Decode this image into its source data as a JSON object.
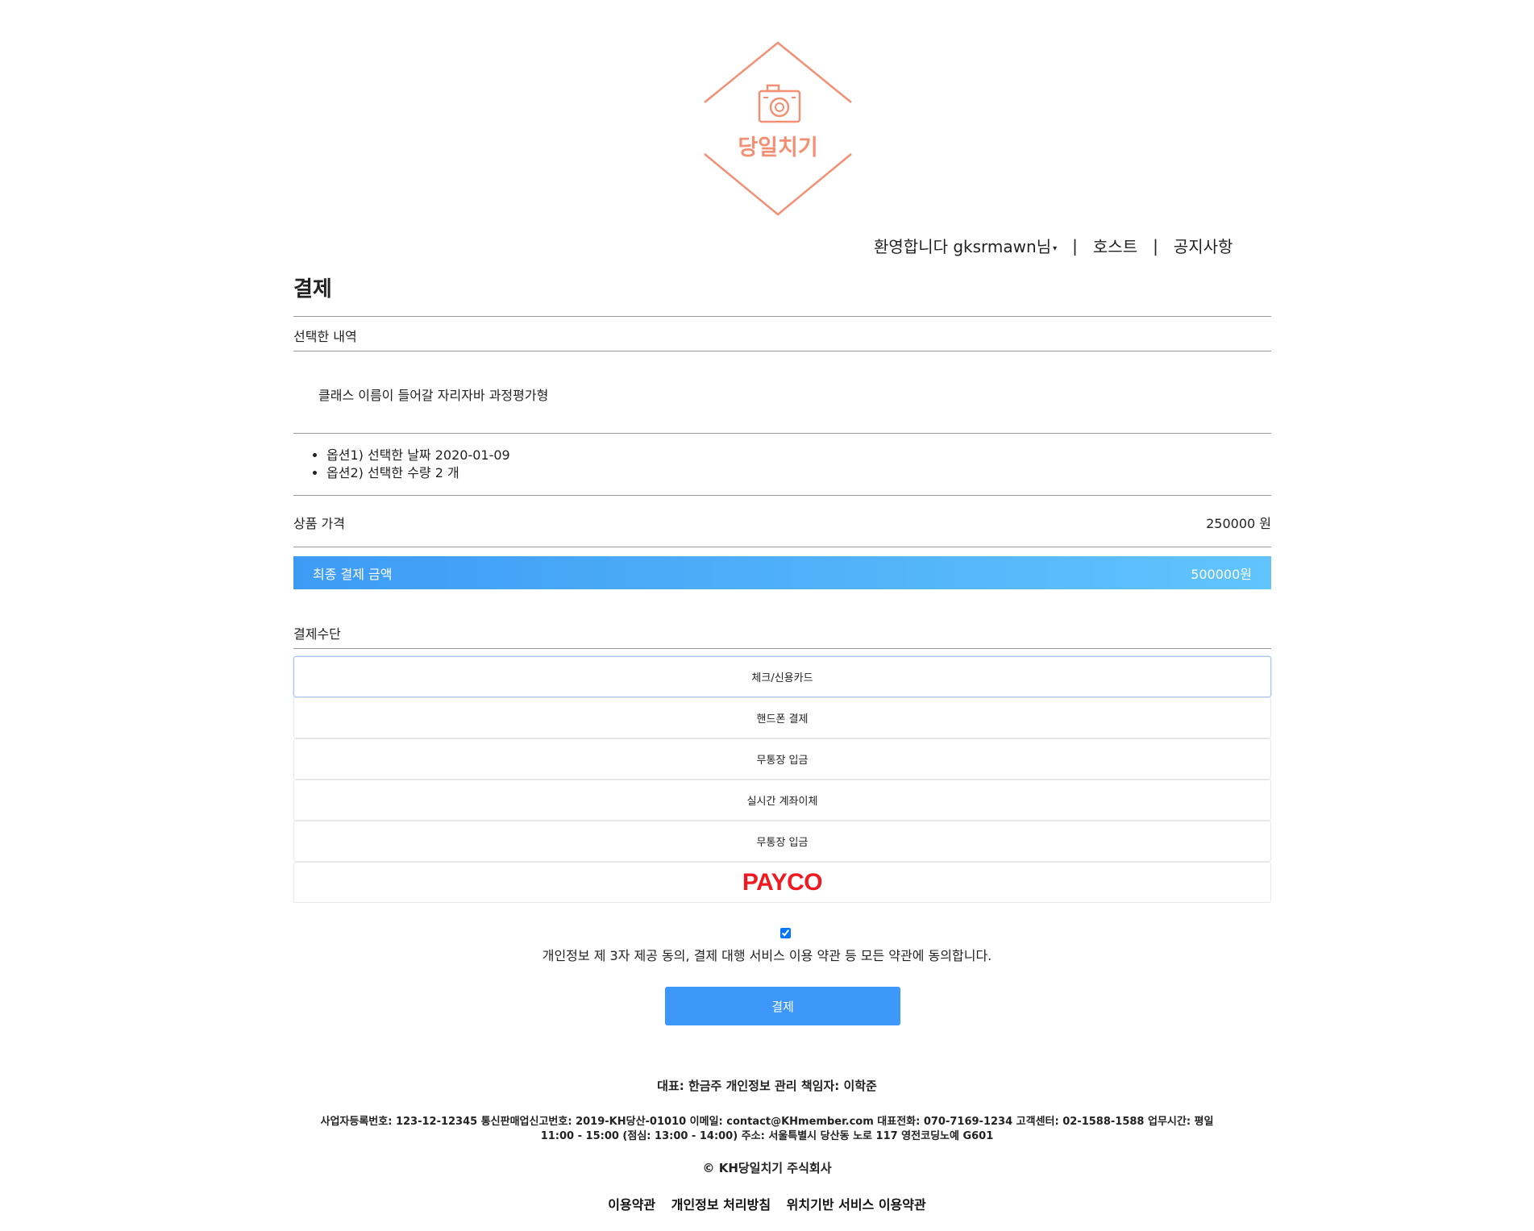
{
  "logo": {
    "brand_text": "당일치기",
    "accent_color": "#f39074",
    "icon": "camera-icon"
  },
  "topnav": {
    "welcome": "환영합니다 gksrmawn님",
    "separator": "|",
    "host": "호스트",
    "notice": "공지사항"
  },
  "page_title": "결제",
  "selection": {
    "header": "선택한 내역",
    "class_name": "클래스 이름이 들어갈 자리자바 과정평가형",
    "options": [
      "옵션1) 선택한 날짜 2020-01-09",
      "옵션2) 선택한 수량 2 개"
    ]
  },
  "price": {
    "label": "상품 가격",
    "value": "250000 원"
  },
  "total": {
    "label": "최종 결제 금액",
    "value": "500000원"
  },
  "payment": {
    "header": "결제수단",
    "methods": [
      "체크/신용카드",
      "핸드폰 결제",
      "무통장 입금",
      "실시간 계좌이체",
      "무통장 입금"
    ],
    "payco": "PAYCO",
    "selected": "체크/신용카드"
  },
  "agreement": {
    "checked": true,
    "text": "개인정보 제 3자 제공 동의, 결제 대행 서비스 이용 약관 등 모든 약관에 동의합니다."
  },
  "submit_label": "결제",
  "footer": {
    "line1": "대표: 한금주 개인정보 관리 책임자: 이학준",
    "line2a": "사업자등록번호: 123-12-12345 통신판매업신고번호: 2019-KH당산-01010 이메일: contact@KHmember.com 대표전화: 070-7169-1234 고객센터: 02-1588-1588 업무시간: 평일",
    "line2b": "11:00 - 15:00 (점심: 13:00 - 14:00) 주소: 서울특별시 당산동 노로 117 영전코딩노예 G601",
    "copyright": "© KH당일치기 주식회사",
    "links": [
      "이용약관",
      "개인정보 처리방침",
      "위치기반 서비스 이용약관"
    ]
  }
}
